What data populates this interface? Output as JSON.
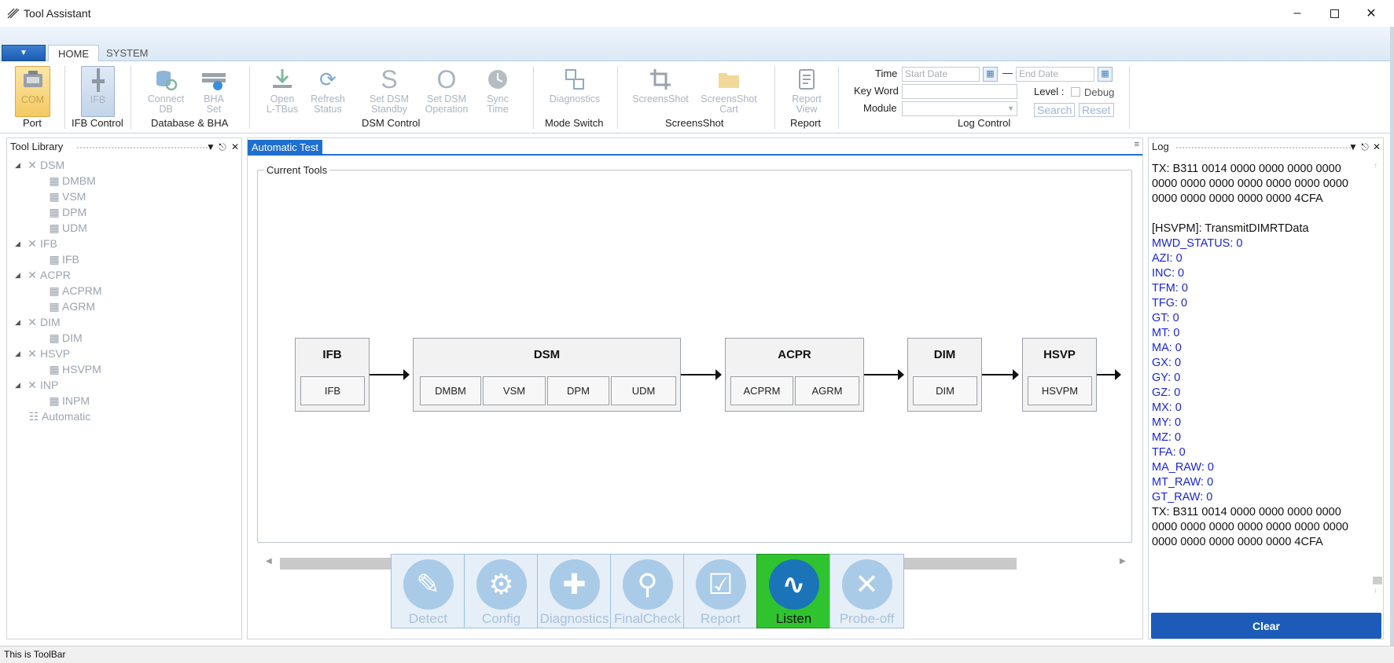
{
  "window": {
    "title": "Tool Assistant"
  },
  "ribbon_tabs": [
    {
      "label": "HOME"
    },
    {
      "label": "SYSTEM"
    }
  ],
  "ribbon": {
    "buttons": {
      "com": "COM",
      "ifb": "IFB",
      "connect_db": [
        "Connect",
        "DB"
      ],
      "bha_set": [
        "BHA",
        "Set"
      ],
      "open_ltbus": [
        "Open",
        "L-TBus"
      ],
      "refresh_status": [
        "Refresh",
        "Status"
      ],
      "set_dsm_standby": [
        "Set DSM",
        "Standby"
      ],
      "set_dsm_operation": [
        "Set DSM",
        "Operation"
      ],
      "sync_time": [
        "Sync",
        "Time"
      ],
      "diagnostics": "Diagnostics",
      "screenshot": "ScreensShot",
      "screenshot_cart": [
        "ScreensShot",
        "Cart"
      ],
      "report_view": [
        "Report",
        "View"
      ]
    },
    "groups": {
      "port": "Port",
      "ifb_control": "IFB Control",
      "database_bha": "Database & BHA",
      "dsm_control": "DSM Control",
      "mode_switch": "Mode Switch",
      "screenshot": "ScreensShot",
      "report": "Report",
      "log_control": "Log Control"
    },
    "log_control": {
      "time_label": "Time",
      "start_placeholder": "Start Date",
      "dash": "—",
      "end_placeholder": "End Date",
      "keyword_label": "Key Word",
      "keyword_value": "",
      "module_label": "Module",
      "module_value": "",
      "level_label": "Level :",
      "debug_label": "Debug",
      "search_label": "Search",
      "reset_label": "Reset"
    }
  },
  "tool_library": {
    "title": "Tool Library",
    "tree": [
      {
        "label": "DSM",
        "children": [
          "DMBM",
          "VSM",
          "DPM",
          "UDM"
        ]
      },
      {
        "label": "IFB",
        "children": [
          "IFB"
        ]
      },
      {
        "label": "ACPR",
        "children": [
          "ACPRM",
          "AGRM"
        ]
      },
      {
        "label": "DIM",
        "children": [
          "DIM"
        ]
      },
      {
        "label": "HSVP",
        "children": [
          "HSVPM"
        ]
      },
      {
        "label": "INP",
        "children": [
          "INPM"
        ]
      }
    ],
    "automatic": "Automatic"
  },
  "main": {
    "tab": "Automatic Test",
    "current_tools_label": "Current Tools",
    "tools": [
      {
        "name": "IFB",
        "modules": [
          "IFB"
        ]
      },
      {
        "name": "DSM",
        "modules": [
          "DMBM",
          "VSM",
          "DPM",
          "UDM"
        ]
      },
      {
        "name": "ACPR",
        "modules": [
          "ACPRM",
          "AGRM"
        ]
      },
      {
        "name": "DIM",
        "modules": [
          "DIM"
        ]
      },
      {
        "name": "HSVP",
        "modules": [
          "HSVPM"
        ]
      }
    ],
    "actions": [
      "Detect",
      "Config",
      "Diagnostics",
      "FinalCheck",
      "Report",
      "Listen",
      "Probe-off"
    ]
  },
  "log": {
    "title": "Log",
    "tx_1": "TX: B311 0014 0000 0000 0000 0000 0000 0000 0000 0000 0000 0000 0000 0000 0000 0000 0000 0000 4CFA",
    "header": "[HSVPM]: TransmitDIMRTData",
    "values": [
      "MWD_STATUS: 0",
      "AZI: 0",
      "INC: 0",
      "TFM: 0",
      "TFG: 0",
      "GT: 0",
      "MT: 0",
      "MA: 0",
      "GX: 0",
      "GY: 0",
      "GZ: 0",
      "MX: 0",
      "MY: 0",
      "MZ: 0",
      "TFA: 0",
      "MA_RAW: 0",
      "MT_RAW: 0",
      "GT_RAW: 0"
    ],
    "tx_2": "TX: B311 0014 0000 0000 0000 0000 0000 0000 0000 0000 0000 0000 0000 0000 0000 0000 0000 0000 4CFA",
    "clear_label": "Clear"
  },
  "statusbar": {
    "text": "This is ToolBar"
  },
  "colors": {
    "accent": "#1f6fd0",
    "listen_bg": "#2fc42f",
    "log_value": "#1a25d6",
    "clear_bg": "#1c5cb8"
  }
}
